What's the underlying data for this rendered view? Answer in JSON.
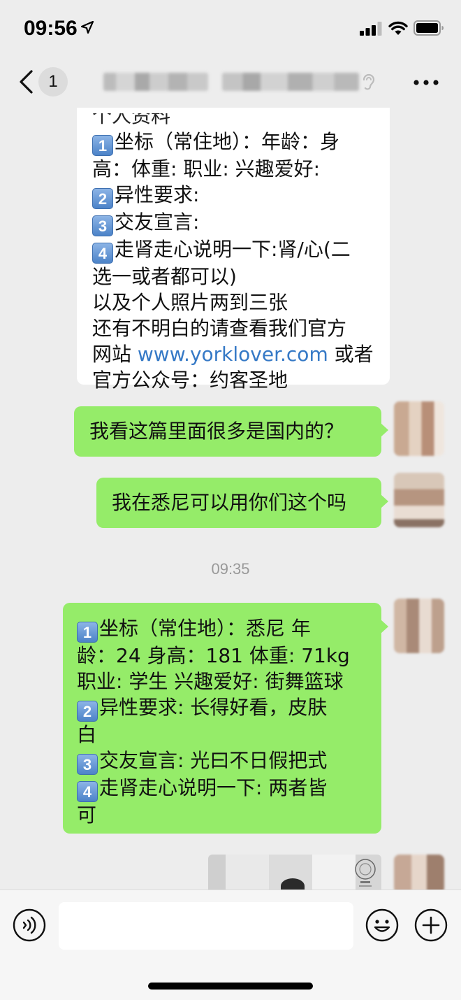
{
  "status_bar": {
    "time": "09:56",
    "icons": [
      "location-arrow-icon",
      "signal-icon",
      "wifi-icon",
      "battery-icon"
    ]
  },
  "nav": {
    "unread_count": "1",
    "icons": [
      "back-chevron-icon",
      "ear-icon",
      "more-icon"
    ]
  },
  "messages": {
    "m1": {
      "line0": "个人资料",
      "l1_text": "坐标（常住地）：年龄：身",
      "l2": "高：体重:  职业: 兴趣爱好:",
      "l3_text": "异性要求:",
      "l4_text": "交友宣言:",
      "l5_text": "走肾走心说明一下:肾/心(二",
      "l6": "选一或者都可以)",
      "l7": "以及个人照片两到三张",
      "l8": "还有不明白的请查看我们官方",
      "l9_pre": "网站 ",
      "l9_link": "www.yorklover.com",
      "l9_post": " 或者",
      "l10": "官方公众号：约客圣地"
    },
    "m2": {
      "text": "我看这篇里面很多是国内的？"
    },
    "m3": {
      "text": "我在悉尼可以用你们这个吗"
    },
    "timestamp": "09:35",
    "m4": {
      "l1_text": "坐标（常住地）：悉尼 年",
      "l2": "龄：24 身高：181 体重:  71kg",
      "l3": "职业: 学生 兴趣爱好: 街舞篮球",
      "l4_text": "异性要求: 长得好看，皮肤",
      "l5": "白",
      "l6_text": "交友宣言: 光曰不日假把式",
      "l7_text": "走肾走心说明一下: 两者皆",
      "l8": "可"
    }
  },
  "number_badges": {
    "n1": "1",
    "n2": "2",
    "n3": "3",
    "n4": "4"
  },
  "colors": {
    "chat_bg": "#ededed",
    "own_bubble": "#95ec69",
    "other_bubble": "#ffffff",
    "link": "#3579c6"
  },
  "input_bar": {
    "icons": [
      "voice-icon",
      "emoji-icon",
      "plus-icon"
    ]
  }
}
